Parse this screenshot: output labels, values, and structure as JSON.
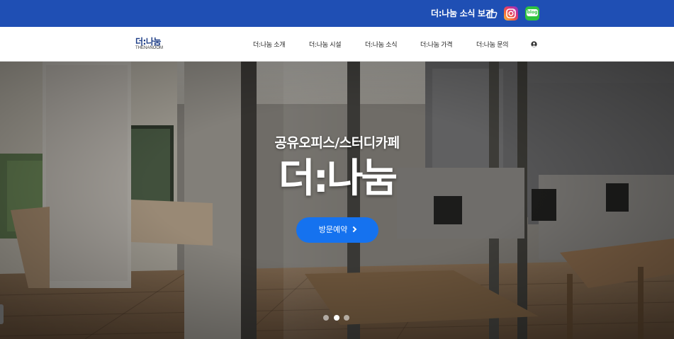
{
  "topbar": {
    "promo_text": "더:나눔 소식 보기",
    "icons": [
      "thumbs-up-icon",
      "instagram-icon",
      "blog-icon"
    ],
    "blog_label": "blog",
    "color": "#1f4fb4"
  },
  "nav": {
    "logo_ko": "더:나눔",
    "logo_en": "THENANOOM",
    "items": [
      {
        "label": "더:나눔 소개"
      },
      {
        "label": "더:나눔 시설"
      },
      {
        "label": "더:나눔 소식"
      },
      {
        "label": "더:나눔 가격"
      },
      {
        "label": "더:나눔 문의"
      }
    ],
    "user_icon": "user-circle-icon"
  },
  "hero": {
    "subtitle": "공유오피스/스터디카페",
    "title": "더:나눔",
    "cta_label": "방문예약",
    "cta_color": "#1572ef",
    "slides_count": 3,
    "active_slide": 2
  }
}
